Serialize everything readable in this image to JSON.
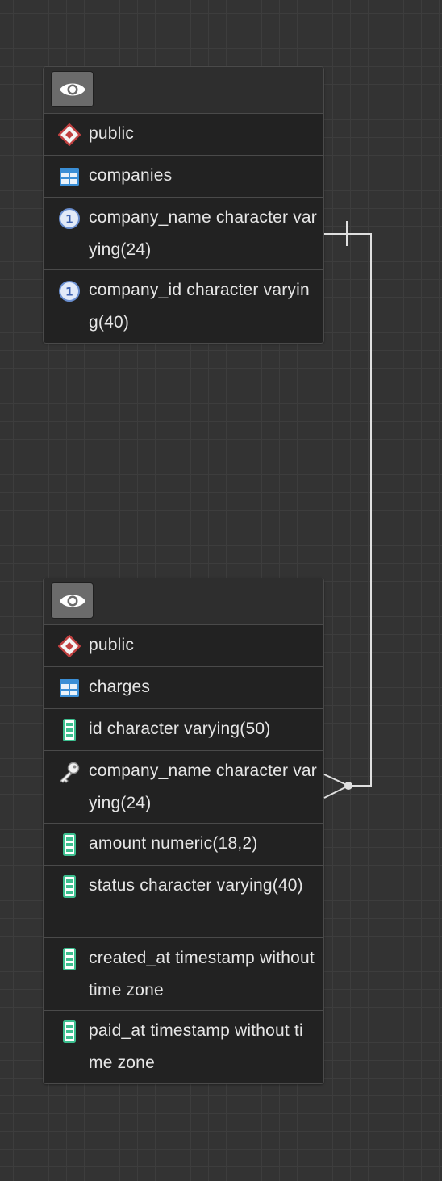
{
  "tables": [
    {
      "schema": "public",
      "name": "companies",
      "columns": [
        {
          "text": "company_name character varying(24)",
          "icon": "unique-icon"
        },
        {
          "text": "company_id character varying(40)",
          "icon": "unique-icon"
        }
      ]
    },
    {
      "schema": "public",
      "name": "charges",
      "columns": [
        {
          "text": "id character varying(50)",
          "icon": "column-icon"
        },
        {
          "text": "company_name character varying(24)",
          "icon": "foreign-key-icon"
        },
        {
          "text": "amount numeric(18,2)",
          "icon": "column-icon"
        },
        {
          "text": "status character varying(40)",
          "icon": "column-icon"
        },
        {
          "text": "created_at timestamp without time zone",
          "icon": "column-icon"
        },
        {
          "text": "paid_at timestamp without time zone",
          "icon": "column-icon"
        }
      ]
    }
  ],
  "relation": {
    "from": "companies.company_name",
    "to": "charges.company_name",
    "cardinality": "one-to-many"
  },
  "colors": {
    "canvas": "#333333",
    "grid": "#3d3d3d",
    "card": "#222222",
    "schema_icon": "#c04040",
    "table_icon": "#3b8fd6",
    "unique_icon": "#6a8fd0",
    "column_icon": "#3cbf8f",
    "line": "#e0e0e0"
  }
}
